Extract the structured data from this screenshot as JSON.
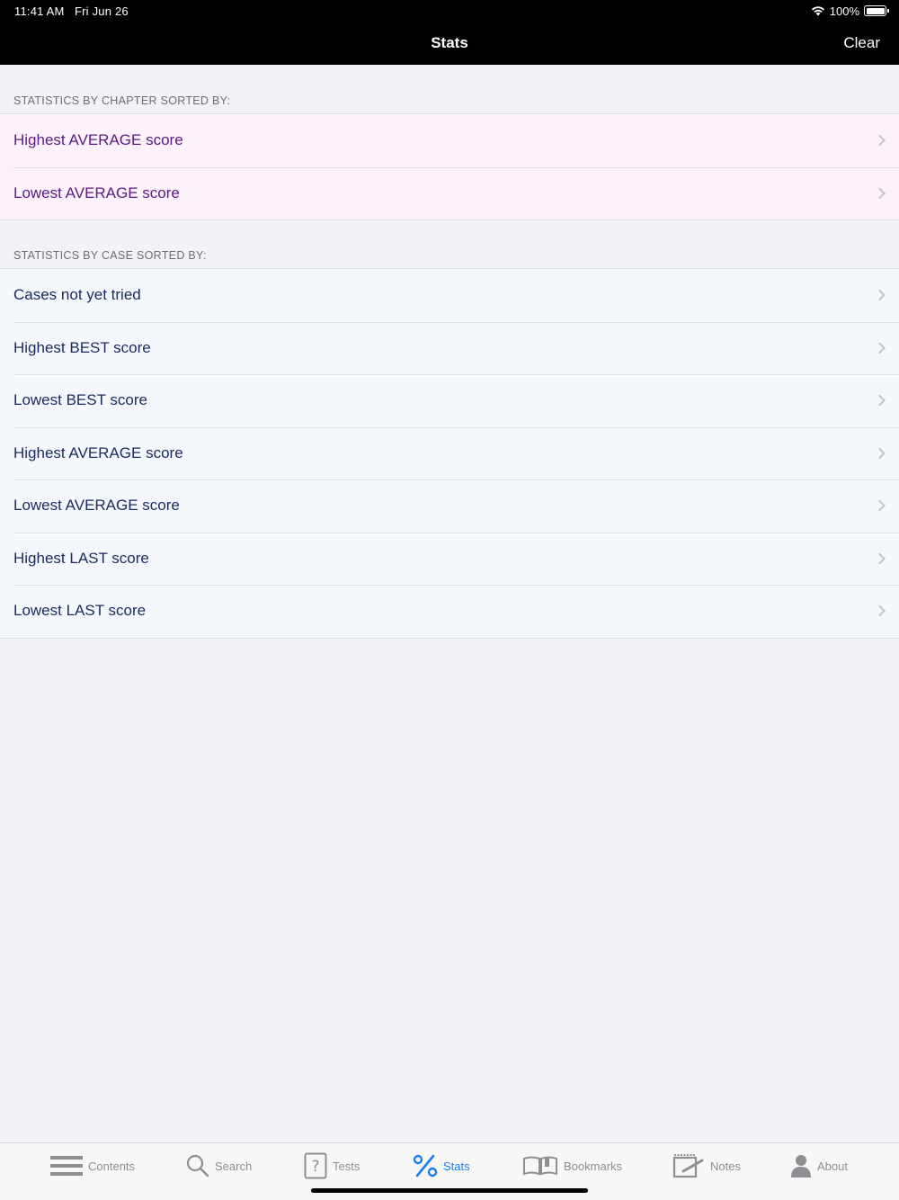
{
  "status_bar": {
    "time": "11:41 AM",
    "date": "Fri Jun 26",
    "battery": "100%"
  },
  "nav": {
    "title": "Stats",
    "right_button": "Clear"
  },
  "chapter_section": {
    "header": "STATISTICS BY CHAPTER SORTED BY:",
    "items": [
      {
        "label": "Highest AVERAGE score"
      },
      {
        "label": "Lowest AVERAGE score"
      }
    ]
  },
  "case_section": {
    "header": "STATISTICS BY CASE SORTED BY:",
    "items": [
      {
        "label": "Cases not yet tried"
      },
      {
        "label": "Highest BEST score"
      },
      {
        "label": "Lowest BEST score"
      },
      {
        "label": "Highest AVERAGE score"
      },
      {
        "label": "Lowest AVERAGE score"
      },
      {
        "label": "Highest LAST score"
      },
      {
        "label": "Lowest LAST score"
      }
    ]
  },
  "tabbar": {
    "active": "Stats",
    "accent_color": "#1a7ef0",
    "inactive_color": "#8e8e93",
    "tabs": [
      {
        "label": "Contents",
        "icon": "list-icon"
      },
      {
        "label": "Search",
        "icon": "search-icon"
      },
      {
        "label": "Tests",
        "icon": "question-icon"
      },
      {
        "label": "Stats",
        "icon": "percent-icon"
      },
      {
        "label": "Bookmarks",
        "icon": "book-icon"
      },
      {
        "label": "Notes",
        "icon": "notepad-icon"
      },
      {
        "label": "About",
        "icon": "person-icon"
      }
    ]
  }
}
